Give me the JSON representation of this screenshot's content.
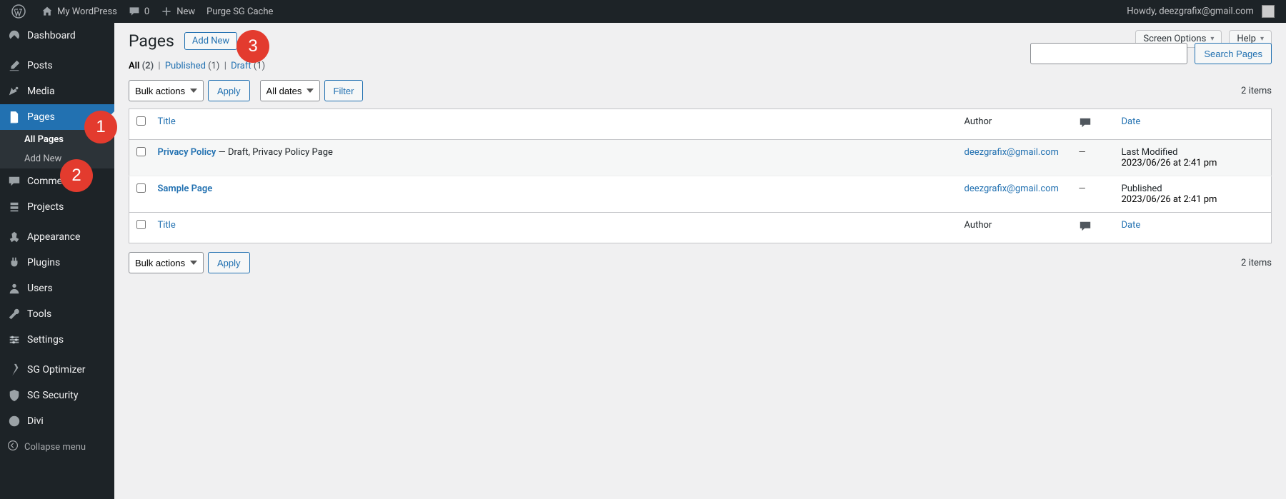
{
  "adminbar": {
    "site_name": "My WordPress",
    "comments_count": "0",
    "new_label": "New",
    "purge_label": "Purge SG Cache",
    "howdy_prefix": "Howdy, ",
    "user": "deezgrafix@gmail.com"
  },
  "sidebar": {
    "items": [
      {
        "id": "dashboard",
        "label": "Dashboard"
      },
      {
        "id": "posts",
        "label": "Posts"
      },
      {
        "id": "media",
        "label": "Media"
      },
      {
        "id": "pages",
        "label": "Pages",
        "current": true,
        "submenu": [
          {
            "id": "all-pages",
            "label": "All Pages",
            "current": true
          },
          {
            "id": "add-new",
            "label": "Add New"
          }
        ]
      },
      {
        "id": "comments",
        "label": "Comments"
      },
      {
        "id": "projects",
        "label": "Projects"
      },
      {
        "id": "appearance",
        "label": "Appearance"
      },
      {
        "id": "plugins",
        "label": "Plugins"
      },
      {
        "id": "users",
        "label": "Users"
      },
      {
        "id": "tools",
        "label": "Tools"
      },
      {
        "id": "settings",
        "label": "Settings"
      },
      {
        "id": "sg-optimizer",
        "label": "SG Optimizer"
      },
      {
        "id": "sg-security",
        "label": "SG Security"
      },
      {
        "id": "divi",
        "label": "Divi"
      }
    ],
    "collapse_label": "Collapse menu"
  },
  "annotations": {
    "a1": "1",
    "a2": "2",
    "a3": "3"
  },
  "screen": {
    "screen_options": "Screen Options",
    "help": "Help"
  },
  "heading": {
    "title": "Pages",
    "add_new": "Add New"
  },
  "filters": {
    "all_label": "All",
    "all_count": "(2)",
    "published_label": "Published",
    "published_count": "(1)",
    "draft_label": "Draft",
    "draft_count": "(1)"
  },
  "search": {
    "button": "Search Pages",
    "value": ""
  },
  "bulk": {
    "selected": "Bulk actions",
    "apply": "Apply",
    "dates": "All dates",
    "filter": "Filter"
  },
  "items_text": "2 items",
  "columns": {
    "title": "Title",
    "author": "Author",
    "date": "Date"
  },
  "rows": [
    {
      "title": "Privacy Policy",
      "state": " — Draft, Privacy Policy Page",
      "author": "deezgrafix@gmail.com",
      "comments": "—",
      "date_line1": "Last Modified",
      "date_line2": "2023/06/26 at 2:41 pm"
    },
    {
      "title": "Sample Page",
      "state": "",
      "author": "deezgrafix@gmail.com",
      "comments": "—",
      "date_line1": "Published",
      "date_line2": "2023/06/26 at 2:41 pm"
    }
  ]
}
